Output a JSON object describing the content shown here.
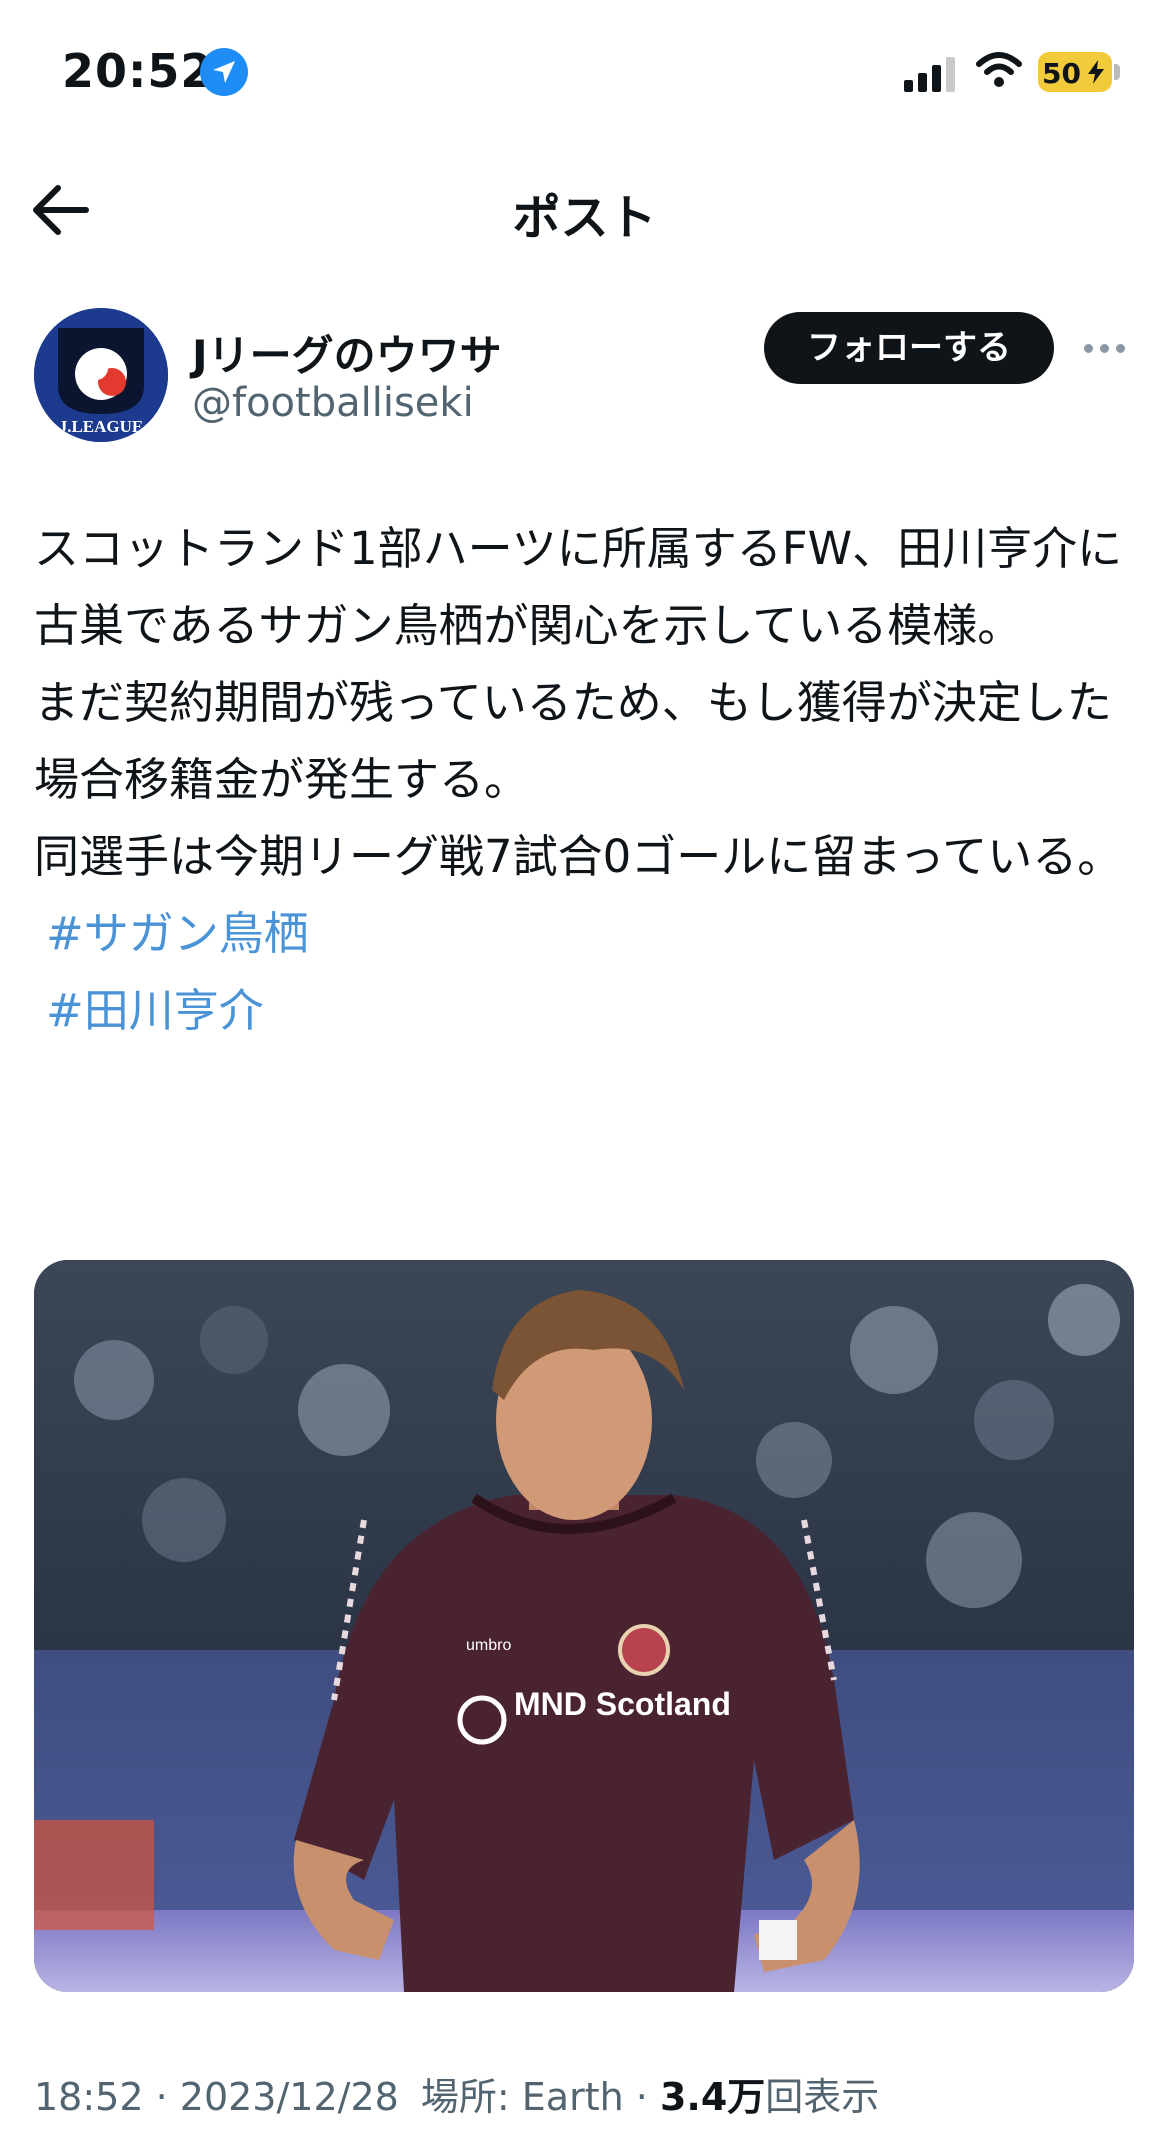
{
  "status_bar": {
    "time": "20:52",
    "battery": "50"
  },
  "header": {
    "title": "ポスト"
  },
  "author": {
    "display_name": "Jリーグのウワサ",
    "handle": "@footballiseki",
    "follow_label": "フォローする",
    "avatar_text": "J.LEAGUE"
  },
  "tweet": {
    "paragraphs": [
      "スコットランド1部ハーツに所属するFW、田川亨介に古巣であるサガン鳥栖が関心を示している模様。",
      "まだ契約期間が残っているため、もし獲得が決定した場合移籍金が発生する。",
      "同選手は今期リーグ戦7試合0ゴールに留まっている。"
    ],
    "hashtags": [
      "#サガン鳥栖",
      "#田川亨介"
    ]
  },
  "media": {
    "jersey_sponsor": "MND Scotland",
    "jersey_brand": "umbro"
  },
  "meta": {
    "time": "18:52",
    "date": "2023/12/28",
    "location": "場所: Earth",
    "views_count": "3.4万",
    "views_label": "回表示"
  },
  "colors": {
    "accent_link": "#4a93d6",
    "follow_button": "#0f1419",
    "battery": "#f2cb3a",
    "location_arrow": "#1d8df5",
    "jersey": "#4a2330"
  },
  "icons": [
    "location-arrow-icon",
    "signal-icon",
    "wifi-icon",
    "battery-icon",
    "back-arrow-icon",
    "more-icon"
  ]
}
